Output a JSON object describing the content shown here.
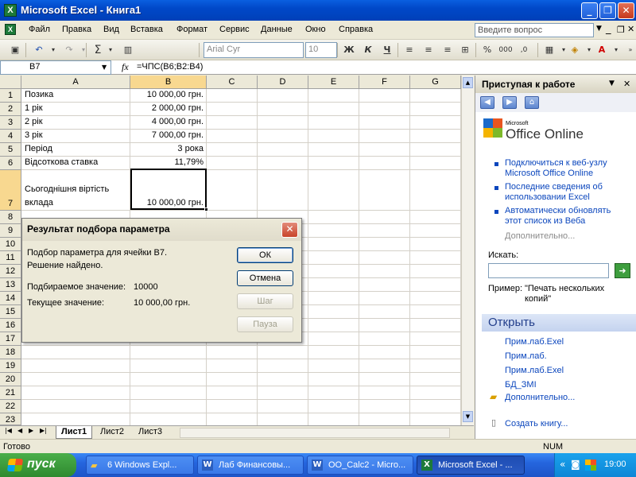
{
  "window": {
    "title": "Microsoft Excel - Книга1",
    "min": "_",
    "restore": "❐",
    "close": "✕"
  },
  "menu": {
    "items": [
      "Файл",
      "Правка",
      "Вид",
      "Вставка",
      "Формат",
      "Сервис",
      "Данные",
      "Окно",
      "Справка"
    ],
    "ask_placeholder": "Введите вопрос"
  },
  "toolbar": {
    "font_name": "Arial Cyr",
    "font_size": "10",
    "bold": "Ж",
    "italic": "К",
    "underline": "Ч",
    "percent": "%",
    "thousands": "000"
  },
  "formula_bar": {
    "name_box": "B7",
    "fx": "fx",
    "formula": "=ЧПС(B6;B2:B4)"
  },
  "grid": {
    "columns": [
      "A",
      "B",
      "C",
      "D",
      "E",
      "F",
      "G"
    ],
    "rows": [
      "1",
      "2",
      "3",
      "4",
      "5",
      "6",
      "7",
      "8",
      "9",
      "10",
      "11",
      "12",
      "13",
      "14",
      "15",
      "16",
      "17",
      "18",
      "19",
      "20",
      "21",
      "22",
      "23"
    ],
    "cells": {
      "A1": "Позика",
      "B1": "10 000,00 грн.",
      "A2": "1 рік",
      "B2": "2 000,00 грн.",
      "A3": "2 рік",
      "B3": "4 000,00 грн.",
      "A4": "3 рік",
      "B4": "7 000,00 грн.",
      "A5": "Період",
      "B5": "3 рока",
      "A6": "Відсоткова ставка",
      "B6": "11,79%",
      "A7a": "Сьогоднішня віртість",
      "A7b": "вклада",
      "B7": "10 000,00 грн."
    }
  },
  "sheets": {
    "tabs": [
      "Лист1",
      "Лист2",
      "Лист3"
    ],
    "active": "Лист1"
  },
  "status": {
    "left": "Готово",
    "num": "NUM"
  },
  "dialog": {
    "title": "Результат подбора параметра",
    "line1": "Подбор параметра для ячейки B7.",
    "line2": "Решение найдено.",
    "target_label": "Подбираемое значение:",
    "target_value": "10000",
    "current_label": "Текущее значение:",
    "current_value": "10 000,00 грн.",
    "ok": "ОК",
    "cancel": "Отмена",
    "step": "Шаг",
    "pause": "Пауза"
  },
  "taskpane": {
    "title": "Приступая к работе",
    "logo_small": "Microsoft",
    "logo": "Office Online",
    "links": [
      [
        "Подключиться к веб-узлу",
        "Microsoft Office Online"
      ],
      [
        "Последние сведения об",
        "использовании Excel"
      ],
      [
        "Автоматически обновлять",
        "этот список из Веба"
      ]
    ],
    "more": "Дополнительно...",
    "search_label": "Искать:",
    "example_label": "Пример:",
    "example_text_1": "\"Печать нескольких",
    "example_text_2": "копий\"",
    "open_header": "Открыть",
    "files": [
      "Прим.лаб.Exel",
      "Прим.лаб.",
      "Прим.лаб.Exel",
      "БД_ЗМІ"
    ],
    "open_more": "Дополнительно...",
    "create": "Создать книгу..."
  },
  "taskbar": {
    "start": "пуск",
    "tasks": [
      "6 Windows Expl...",
      "Лаб Финансовы...",
      "OO_Calc2 - Micro...",
      "Microsoft Excel - ..."
    ],
    "clock": "19:00"
  },
  "colors": {
    "selected_header": "#F8D890",
    "title_bar": "#0A5FE0",
    "link": "#0B46BD"
  }
}
